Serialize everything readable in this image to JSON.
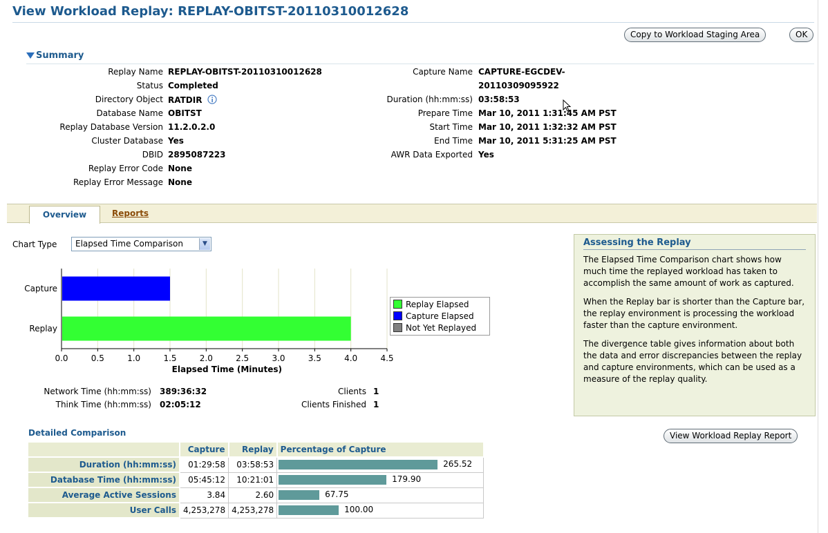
{
  "header": {
    "title": "View Workload Replay: REPLAY-OBITST-20110310012628",
    "copy_button": "Copy to Workload Staging Area",
    "ok_button": "OK"
  },
  "summary": {
    "heading": "Summary",
    "left": [
      {
        "label": "Replay Name",
        "value": "REPLAY-OBITST-20110310012628"
      },
      {
        "label": "Status",
        "value": "Completed"
      },
      {
        "label": "Directory Object",
        "value": "RATDIR"
      },
      {
        "label": "Database Name",
        "value": "OBITST"
      },
      {
        "label": "Replay Database Version",
        "value": "11.2.0.2.0"
      },
      {
        "label": "Cluster Database",
        "value": "Yes"
      },
      {
        "label": "DBID",
        "value": "2895087223"
      },
      {
        "label": "Replay Error Code",
        "value": "None"
      },
      {
        "label": "Replay Error Message",
        "value": "None"
      }
    ],
    "right": {
      "capture_name_label": "Capture Name",
      "capture_name_line1": "CAPTURE-EGCDEV-",
      "capture_name_line2": "20110309095922",
      "rows": [
        {
          "label": "Duration (hh:mm:ss)",
          "value": "03:58:53"
        },
        {
          "label": "Prepare Time",
          "value": "Mar 10, 2011 1:31:45 AM PST"
        },
        {
          "label": "Start Time",
          "value": "Mar 10, 2011 1:32:32 AM PST"
        },
        {
          "label": "End Time",
          "value": "Mar 10, 2011 5:31:25 AM PST"
        },
        {
          "label": "AWR Data Exported",
          "value": "Yes"
        }
      ]
    }
  },
  "tabs": {
    "overview": "Overview",
    "reports": "Reports"
  },
  "chart_type": {
    "label": "Chart Type",
    "selected": "Elapsed Time Comparison"
  },
  "chart_data": {
    "type": "bar",
    "orientation": "horizontal",
    "categories": [
      "Capture",
      "Replay"
    ],
    "values": [
      1.5,
      4.0
    ],
    "colors": [
      "#0000ff",
      "#33ff33"
    ],
    "xlabel": "Elapsed Time (Minutes)",
    "xlim": [
      0,
      4.5
    ],
    "xticks": [
      "0.0",
      "0.5",
      "1.0",
      "1.5",
      "2.0",
      "2.5",
      "3.0",
      "3.5",
      "4.0",
      "4.5"
    ],
    "grid": true,
    "legend": [
      {
        "name": "Replay Elapsed",
        "color": "#33ff33"
      },
      {
        "name": "Capture Elapsed",
        "color": "#0000ff"
      },
      {
        "name": "Not Yet Replayed",
        "color": "#808080"
      }
    ],
    "legend_position": "right"
  },
  "stats": {
    "network_time_label": "Network Time (hh:mm:ss)",
    "network_time": "389:36:32",
    "think_time_label": "Think Time (hh:mm:ss)",
    "think_time": "02:05:12",
    "clients_label": "Clients",
    "clients": "1",
    "clients_finished_label": "Clients Finished",
    "clients_finished": "1"
  },
  "assess": {
    "title": "Assessing the Replay",
    "p1": "The Elapsed Time Comparison chart shows how much time the replayed workload has taken to accomplish the same amount of work as captured.",
    "p2": "When the Replay bar is shorter than the Capture bar, the replay environment is processing the workload faster than the capture environment.",
    "p3": "The divergence table gives information about both the data and error discrepancies between the replay and capture environments, which can be used as a measure of the replay quality."
  },
  "report_button": "View Workload Replay Report",
  "detailed": {
    "heading": "Detailed Comparison",
    "columns": [
      "Capture",
      "Replay",
      "Percentage of Capture"
    ],
    "rows": [
      {
        "label": "Duration (hh:mm:ss)",
        "capture": "01:29:58",
        "replay": "03:58:53",
        "pct": 265.52,
        "pct_label": "265.52"
      },
      {
        "label": "Database Time (hh:mm:ss)",
        "capture": "05:45:12",
        "replay": "10:21:01",
        "pct": 179.9,
        "pct_label": "179.90"
      },
      {
        "label": "Average Active Sessions",
        "capture": "3.84",
        "replay": "2.60",
        "pct": 67.75,
        "pct_label": "67.75"
      },
      {
        "label": "User Calls",
        "capture": "4,253,278",
        "replay": "4,253,278",
        "pct": 100.0,
        "pct_label": "100.00"
      }
    ]
  }
}
